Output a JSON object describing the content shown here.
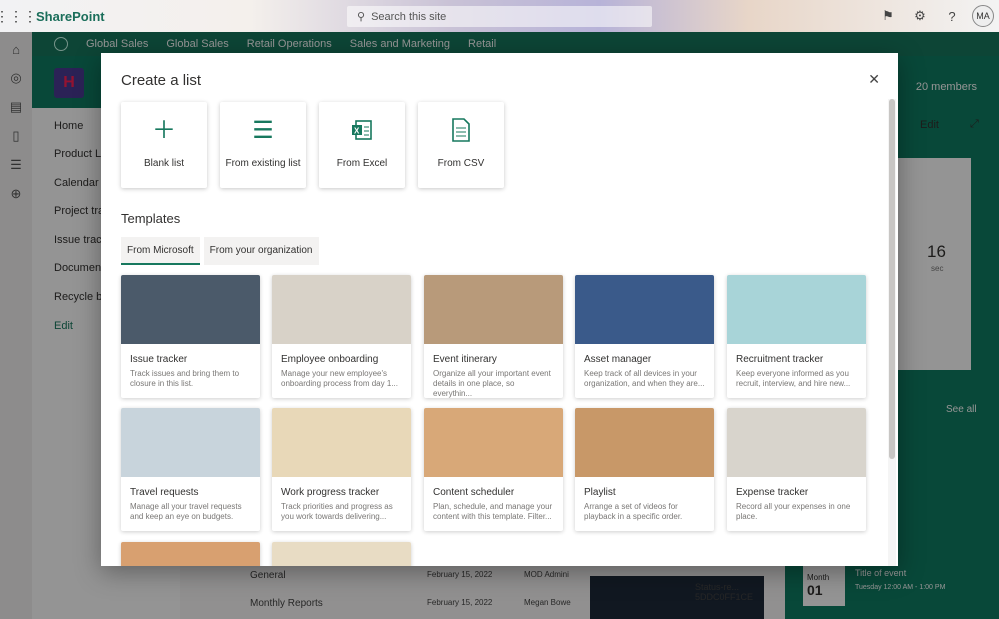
{
  "topbar": {
    "app_name": "SharePoint",
    "search_placeholder": "Search this site",
    "avatar_initials": "MA"
  },
  "hubnav": {
    "items": [
      "Global Sales",
      "Global Sales",
      "Retail Operations",
      "Sales and Marketing",
      "Retail"
    ]
  },
  "site": {
    "members": "20 members",
    "edit_label": "Edit"
  },
  "leftnav": {
    "items": [
      "Home",
      "Product List",
      "Calendar",
      "Project track",
      "Issue tracke",
      "Documents",
      "Recycle bin",
      "Edit"
    ]
  },
  "background": {
    "rows": [
      {
        "name": "General",
        "date": "February 15, 2022",
        "author": "MOD Admini"
      },
      {
        "name": "Monthly Reports",
        "date": "February 15, 2022",
        "author": "Megan Bowe"
      }
    ],
    "status_tile": "Status-re... 5DDC0FF1CE",
    "event_month": "Month",
    "event_day": "01",
    "event_title": "Title of event",
    "event_time": "Tuesday 12:00 AM - 1:00 PM",
    "see_all": "See all",
    "countdown_value": "16",
    "countdown_unit": "sec"
  },
  "dialog": {
    "title": "Create a list",
    "close_icon": "close-icon",
    "create_options": [
      {
        "label": "Blank list",
        "icon": "plus-icon"
      },
      {
        "label": "From existing list",
        "icon": "list-lines-icon"
      },
      {
        "label": "From Excel",
        "icon": "excel-icon"
      },
      {
        "label": "From CSV",
        "icon": "csv-file-icon"
      }
    ],
    "templates_heading": "Templates",
    "tabs": [
      "From Microsoft",
      "From your organization"
    ],
    "templates": [
      {
        "title": "Issue tracker",
        "desc": "Track issues and bring them to closure in this list.",
        "color": "#4b5a6a"
      },
      {
        "title": "Employee onboarding",
        "desc": "Manage your new employee's onboarding process from day 1...",
        "color": "#d8d2c8"
      },
      {
        "title": "Event itinerary",
        "desc": "Organize all your important event details in one place, so everythin...",
        "color": "#b89a7a"
      },
      {
        "title": "Asset manager",
        "desc": "Keep track of all devices in your organization, and when they are...",
        "color": "#3a5a8a"
      },
      {
        "title": "Recruitment tracker",
        "desc": "Keep everyone informed as you recruit, interview, and hire new...",
        "color": "#a8d4d8"
      },
      {
        "title": "Travel requests",
        "desc": "Manage all your travel requests and keep an eye on budgets.",
        "color": "#c8d4dc"
      },
      {
        "title": "Work progress tracker",
        "desc": "Track priorities and progress as you work towards delivering...",
        "color": "#e8d8b8"
      },
      {
        "title": "Content scheduler",
        "desc": "Plan, schedule, and manage your content with this template. Filter...",
        "color": "#d8a878"
      },
      {
        "title": "Playlist",
        "desc": "Arrange a set of videos for playback in a specific order.",
        "color": "#c89868"
      },
      {
        "title": "Expense tracker",
        "desc": "Record all your expenses in one place.",
        "color": "#d8d4cc"
      }
    ]
  }
}
